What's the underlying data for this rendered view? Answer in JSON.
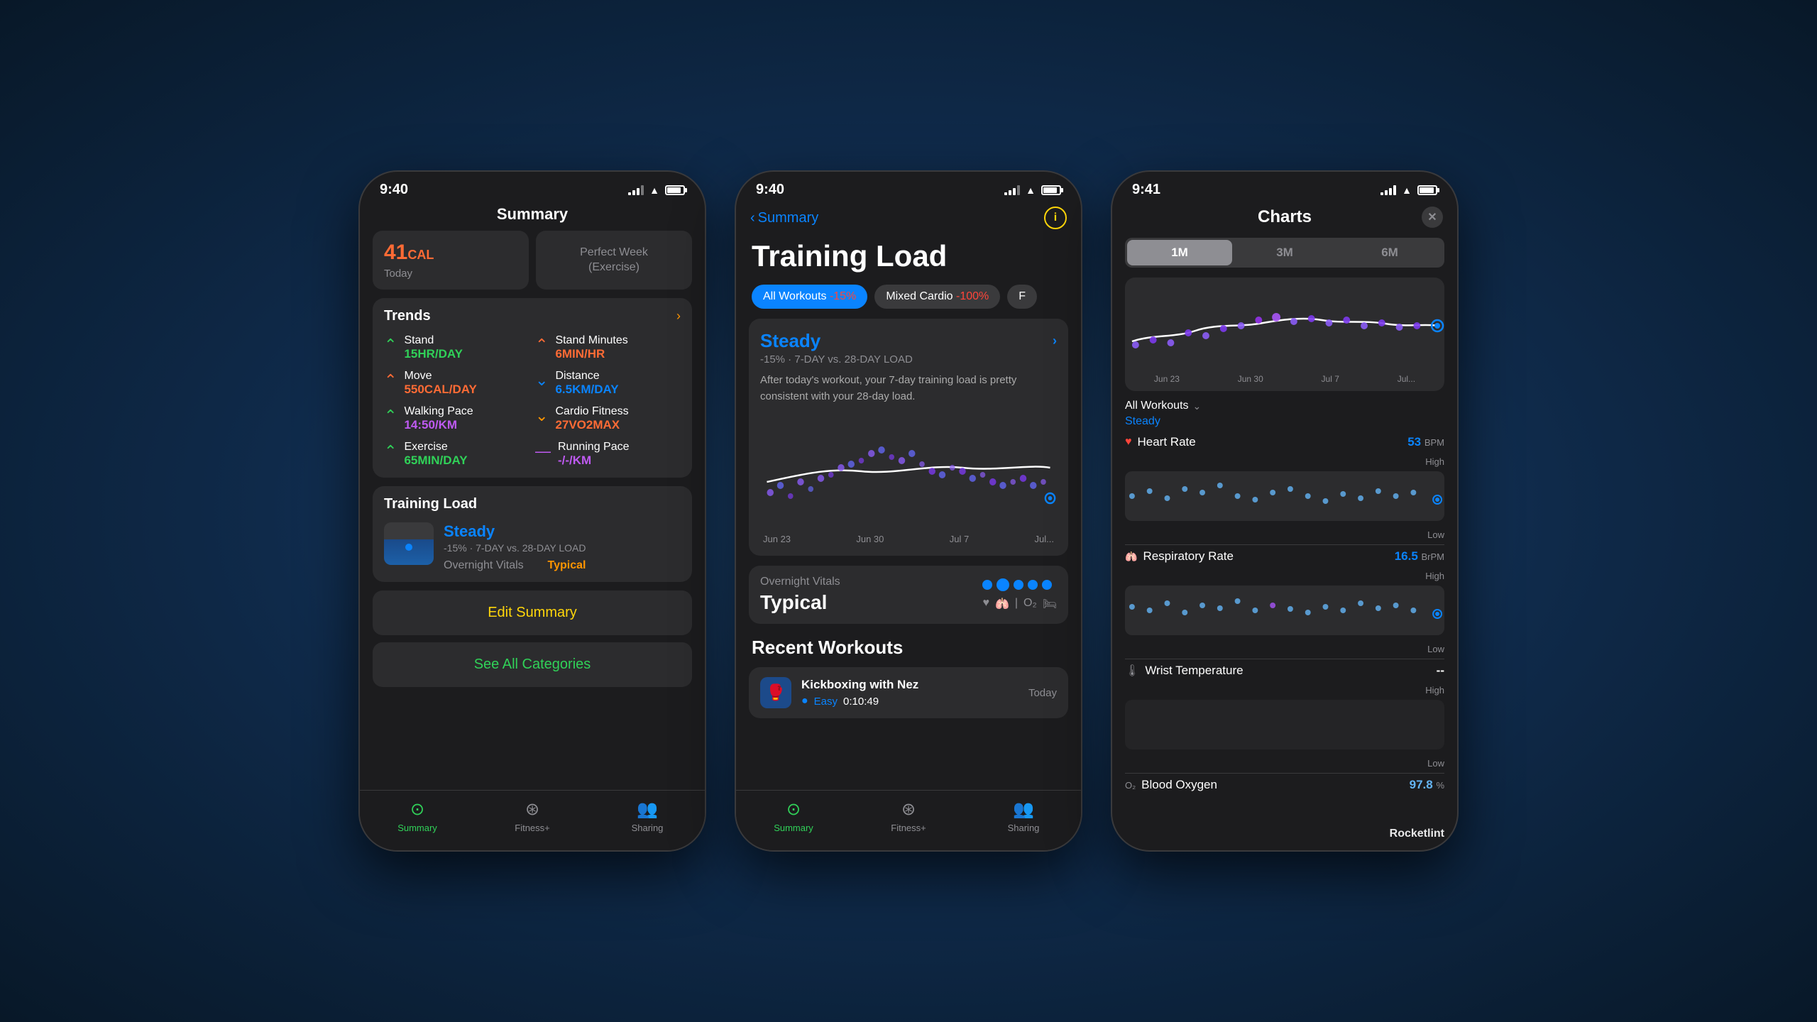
{
  "background": "#1a3a5c",
  "phones": {
    "phone1": {
      "status_time": "9:40",
      "title": "Summary",
      "calories": "41CAL",
      "calories_label": "Today",
      "perfect_week": "Perfect Week\n(Exercise)",
      "trends_title": "Trends",
      "trends": [
        {
          "name": "Stand",
          "value": "15HR/DAY",
          "color": "green",
          "arrow": "up"
        },
        {
          "name": "Stand Minutes",
          "value": "6MIN/HR",
          "color": "orange",
          "arrow": "up-orange"
        },
        {
          "name": "Move",
          "value": "550CAL/DAY",
          "color": "orange",
          "arrow": "up-orange"
        },
        {
          "name": "Distance",
          "value": "6.5KM/DAY",
          "color": "blue",
          "arrow": "down"
        },
        {
          "name": "Walking Pace",
          "value": "14:50/KM",
          "color": "purple",
          "arrow": "up"
        },
        {
          "name": "Cardio Fitness",
          "value": "27VO2MAX",
          "color": "orange",
          "arrow": "down-orange"
        },
        {
          "name": "Exercise",
          "value": "65MIN/DAY",
          "color": "green",
          "arrow": "up"
        },
        {
          "name": "Running Pace",
          "value": "-/-/KM",
          "color": "white",
          "arrow": "dash"
        }
      ],
      "training_load_title": "Training Load",
      "steady": "Steady",
      "tl_subtitle": "-15% · 7-DAY vs. 28-DAY LOAD",
      "overnight_vitals": "Overnight Vitals",
      "typical": "Typical",
      "edit_summary": "Edit Summary",
      "see_all_categories": "See All Categories",
      "tabs": [
        {
          "label": "Summary",
          "active": true
        },
        {
          "label": "Fitness+",
          "active": false
        },
        {
          "label": "Sharing",
          "active": false
        }
      ]
    },
    "phone2": {
      "status_time": "9:40",
      "back_label": "Summary",
      "title": "Training Load",
      "filters": [
        {
          "label": "All Workouts -15%",
          "active": true
        },
        {
          "label": "Mixed Cardio -100%",
          "active": false
        }
      ],
      "steady": "Steady",
      "steady_subtitle": "-15% · 7-DAY vs. 28-DAY LOAD",
      "steady_desc": "After today's workout, your 7-day training load is pretty consistent with your 28-day load.",
      "chart_dates": [
        "Jun 23",
        "Jun 30",
        "Jul 7",
        "Jul..."
      ],
      "overnight_label": "Overnight Vitals",
      "overnight_value": "Typical",
      "recent_workouts_title": "Recent Workouts",
      "workout_name": "Kickboxing with Nez",
      "workout_difficulty": "Easy",
      "workout_time": "0:10:49",
      "workout_date": "Today",
      "tabs": [
        {
          "label": "Summary",
          "active": true
        },
        {
          "label": "Fitness+",
          "active": false
        },
        {
          "label": "Sharing",
          "active": false
        }
      ]
    },
    "phone3": {
      "status_time": "9:41",
      "title": "Charts",
      "periods": [
        "1M",
        "3M",
        "6M"
      ],
      "active_period": "1M",
      "chart_dates": [
        "Jun 23",
        "Jun 30",
        "Jul 7",
        "Jul..."
      ],
      "all_workouts": "All Workouts",
      "steady": "Steady",
      "metrics": [
        {
          "icon": "♥",
          "name": "Heart Rate",
          "value": "53",
          "unit": "BPM",
          "color": "blue"
        },
        {
          "icon": "🫁",
          "name": "Respiratory Rate",
          "value": "16.5",
          "unit": "BrPM",
          "color": "blue"
        },
        {
          "icon": "🌡",
          "name": "Wrist Temperature",
          "value": "--",
          "unit": "",
          "color": "white"
        },
        {
          "icon": "O₂",
          "name": "Blood Oxygen",
          "value": "97.8",
          "unit": "%",
          "color": "blue-light"
        }
      ],
      "high_label": "High",
      "low_label": "Low"
    }
  }
}
